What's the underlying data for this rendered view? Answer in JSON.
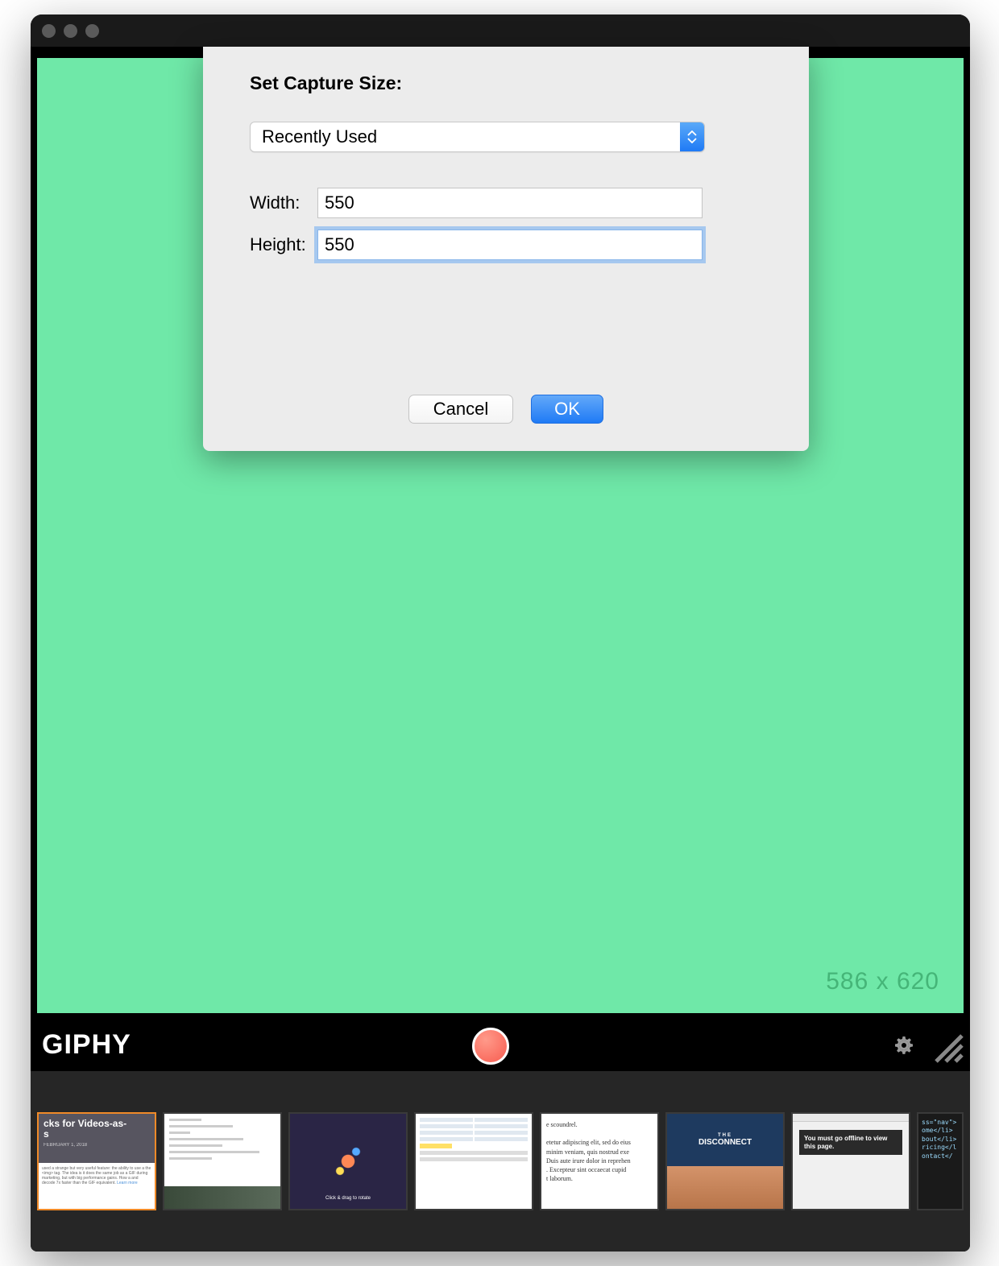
{
  "dialog": {
    "title": "Set Capture Size:",
    "dropdown_value": "Recently Used",
    "width_label": "Width:",
    "width_value": "550",
    "height_label": "Height:",
    "height_value": "550",
    "cancel_label": "Cancel",
    "ok_label": "OK"
  },
  "capture": {
    "dimensions_label": "586 x 620"
  },
  "brand": "GIPHY",
  "thumbnails": {
    "t1_title": "cks for Videos-as-\ns",
    "t1_date": "FEBRUARY 1, 2018",
    "t5_text": "e scoundrel.\n\netetur adipiscing elit, sed do eius\nminim veniam, quis nostrud exe\nDuis aute irure dolor in reprehen\n. Excepteur sint occaecat cupid\nt laborum.",
    "t6_the": "THE",
    "t6_title": "DISCONNECT",
    "t7_msg": "You must go offline to view this page.",
    "t8_code": "ss=\"nav\">\nome</li>\nbout</li>\nricing</l\nontact</"
  }
}
